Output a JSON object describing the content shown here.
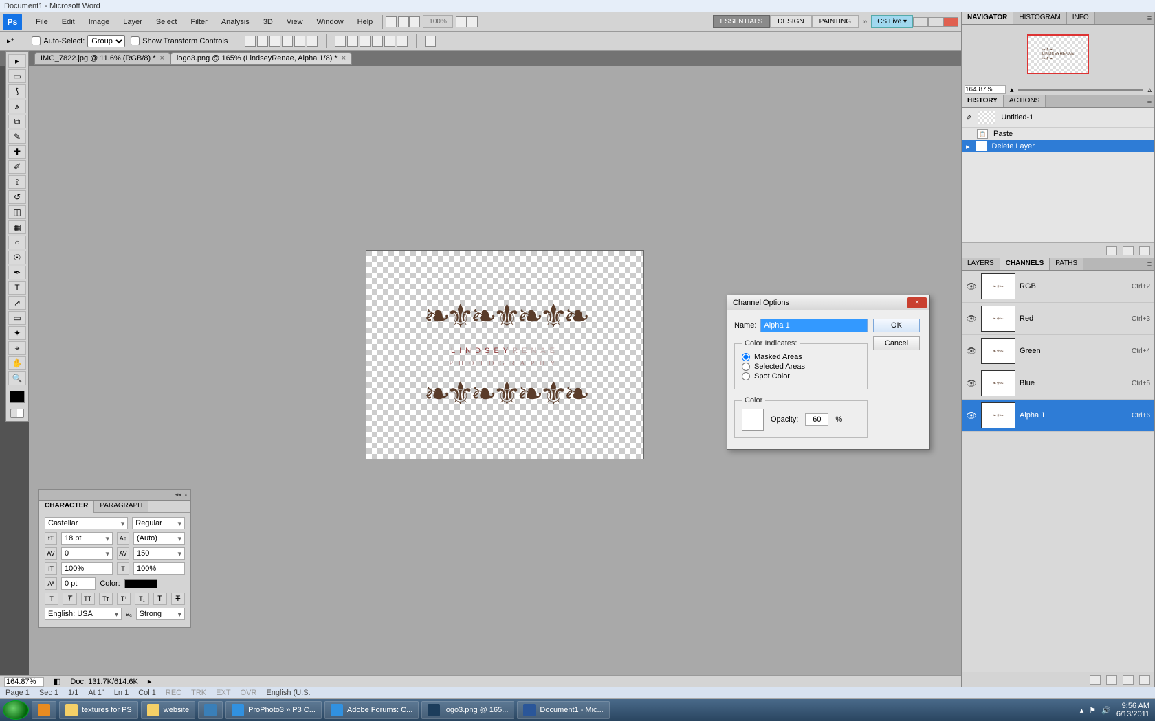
{
  "word": {
    "title": "Document1 - Microsoft Word",
    "status": {
      "page": "Page  1",
      "sec": "Sec 1",
      "pages": "1/1",
      "at": "At  1\"",
      "ln": "Ln  1",
      "col": "Col  1",
      "rec": "REC",
      "trk": "TRK",
      "ext": "EXT",
      "ovr": "OVR",
      "lang": "English (U.S."
    }
  },
  "menu": [
    "File",
    "Edit",
    "Image",
    "Layer",
    "Select",
    "Filter",
    "Analysis",
    "3D",
    "View",
    "Window",
    "Help"
  ],
  "workspaces": {
    "active": "ESSENTIALS",
    "items": [
      "DESIGN",
      "PAINTING"
    ]
  },
  "cslive": "CS Live ▾",
  "toolbar_zoom": "100%",
  "options": {
    "autoselect": "Auto-Select:",
    "autoselect_value": "Group",
    "transform": "Show Transform Controls"
  },
  "tabs": [
    {
      "label": "IMG_7822.jpg @ 11.6% (RGB/8) *",
      "active": false
    },
    {
      "label": "logo3.png @ 165% (LindseyRenae, Alpha 1/8) *",
      "active": true
    }
  ],
  "logo": {
    "line1a": "LINDSEY",
    "line1b": "RENAE",
    "line2": "PHOTOGRAPHY"
  },
  "dialog": {
    "title": "Channel Options",
    "name_label": "Name:",
    "name_value": "Alpha 1",
    "ok": "OK",
    "cancel": "Cancel",
    "ci_legend": "Color Indicates:",
    "radios": [
      "Masked Areas",
      "Selected Areas",
      "Spot Color"
    ],
    "color_legend": "Color",
    "opacity_label": "Opacity:",
    "opacity_value": "60",
    "percent": "%"
  },
  "status": {
    "zoom": "164.87%",
    "doc": "Doc: 131.7K/614.6K"
  },
  "char": {
    "tabs": [
      "CHARACTER",
      "PARAGRAPH"
    ],
    "font": "Castellar",
    "style": "Regular",
    "size": "18 pt",
    "leading": "(Auto)",
    "kern": "0",
    "track": "150",
    "vscale": "100%",
    "hscale": "100%",
    "baseline": "0 pt",
    "color_label": "Color:",
    "lang": "English: USA",
    "aa": "Strong"
  },
  "navigator": {
    "tabs": [
      "NAVIGATOR",
      "HISTOGRAM",
      "INFO"
    ],
    "zoom": "164.87%"
  },
  "history": {
    "tabs": [
      "HISTORY",
      "ACTIONS"
    ],
    "doc": "Untitled-1",
    "items": [
      {
        "label": "Paste",
        "sel": false
      },
      {
        "label": "Delete Layer",
        "sel": true
      }
    ]
  },
  "channels": {
    "tabs": [
      "LAYERS",
      "CHANNELS",
      "PATHS"
    ],
    "rows": [
      {
        "label": "RGB",
        "sc": "Ctrl+2",
        "sel": false
      },
      {
        "label": "Red",
        "sc": "Ctrl+3",
        "sel": false
      },
      {
        "label": "Green",
        "sc": "Ctrl+4",
        "sel": false
      },
      {
        "label": "Blue",
        "sc": "Ctrl+5",
        "sel": false
      },
      {
        "label": "Alpha 1",
        "sc": "Ctrl+6",
        "sel": true
      }
    ]
  },
  "taskbar": {
    "items": [
      {
        "label": "",
        "kind": "mp"
      },
      {
        "label": "textures for PS",
        "kind": "folder"
      },
      {
        "label": "website",
        "kind": "folder"
      },
      {
        "label": "",
        "kind": "app"
      },
      {
        "label": "ProPhoto3 » P3 C...",
        "kind": "ie"
      },
      {
        "label": "Adobe Forums: C...",
        "kind": "ie"
      },
      {
        "label": "logo3.png @ 165...",
        "kind": "ps"
      },
      {
        "label": "Document1 - Mic...",
        "kind": "wd"
      }
    ],
    "time": "9:56 AM",
    "date": "6/13/2011"
  }
}
